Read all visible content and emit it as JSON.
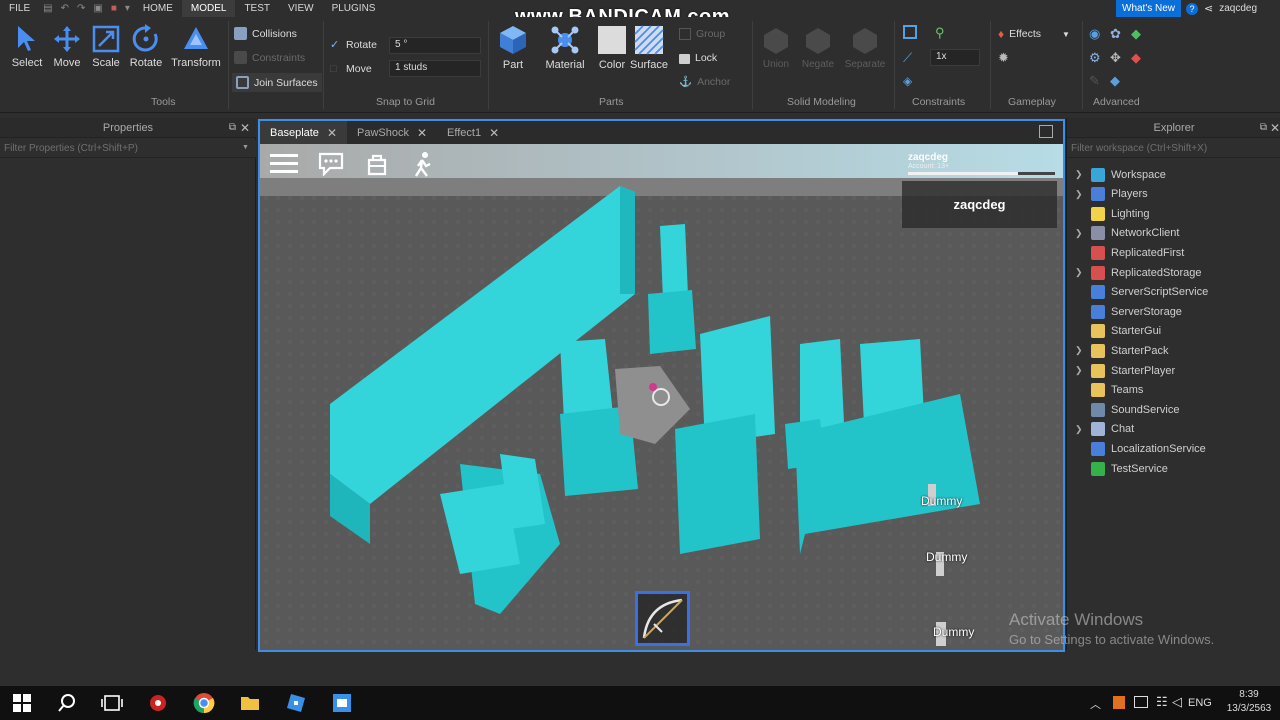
{
  "menubar": {
    "items": [
      "FILE",
      "HOME",
      "MODEL",
      "TEST",
      "VIEW",
      "PLUGINS"
    ],
    "active": "MODEL",
    "whats_new": "What's New",
    "username": "zaqcdeg"
  },
  "watermark": "www.BANDICAM.com",
  "ribbon": {
    "tools": {
      "select": "Select",
      "move": "Move",
      "scale": "Scale",
      "rotate": "Rotate",
      "transform": "Transform",
      "label": "Tools"
    },
    "collisions": "Collisions",
    "constraints_dim": "Constraints",
    "join_surfaces": "Join Surfaces",
    "snap": {
      "rotate_label": "Rotate",
      "rotate_value": "5 °",
      "move_label": "Move",
      "move_value": "1 studs",
      "label": "Snap to Grid"
    },
    "parts": {
      "part": "Part",
      "material": "Material",
      "color": "Color",
      "surface": "Surface",
      "group": "Group",
      "lock": "Lock",
      "anchor": "Anchor",
      "label": "Parts"
    },
    "solid": {
      "union": "Union",
      "negate": "Negate",
      "separate": "Separate",
      "label": "Solid Modeling"
    },
    "constraints": {
      "scale_value": "1x",
      "label": "Constraints"
    },
    "gameplay": {
      "effects": "Effects",
      "label": "Gameplay"
    },
    "advanced": {
      "label": "Advanced"
    }
  },
  "properties": {
    "title": "Properties",
    "filter_placeholder": "Filter Properties (Ctrl+Shift+P)"
  },
  "explorer": {
    "title": "Explorer",
    "filter_placeholder": "Filter workspace (Ctrl+Shift+X)",
    "items": [
      {
        "label": "Workspace",
        "expandable": true,
        "color": "#3aa6d8"
      },
      {
        "label": "Players",
        "expandable": true,
        "color": "#4a7fd9"
      },
      {
        "label": "Lighting",
        "expandable": false,
        "color": "#f1d24a"
      },
      {
        "label": "NetworkClient",
        "expandable": true,
        "color": "#8a8fa6"
      },
      {
        "label": "ReplicatedFirst",
        "expandable": false,
        "color": "#d65050"
      },
      {
        "label": "ReplicatedStorage",
        "expandable": true,
        "color": "#d65050"
      },
      {
        "label": "ServerScriptService",
        "expandable": false,
        "color": "#4a7fd9"
      },
      {
        "label": "ServerStorage",
        "expandable": false,
        "color": "#4a7fd9"
      },
      {
        "label": "StarterGui",
        "expandable": false,
        "color": "#e8c25a"
      },
      {
        "label": "StarterPack",
        "expandable": true,
        "color": "#e8c25a"
      },
      {
        "label": "StarterPlayer",
        "expandable": true,
        "color": "#e8c25a"
      },
      {
        "label": "Teams",
        "expandable": false,
        "color": "#e8c25a"
      },
      {
        "label": "SoundService",
        "expandable": false,
        "color": "#6f8aa8"
      },
      {
        "label": "Chat",
        "expandable": true,
        "color": "#9fb4d8"
      },
      {
        "label": "LocalizationService",
        "expandable": false,
        "color": "#4a7fd9"
      },
      {
        "label": "TestService",
        "expandable": false,
        "color": "#35b04a"
      }
    ]
  },
  "tabs": [
    {
      "label": "Baseplate",
      "active": true
    },
    {
      "label": "PawShock",
      "active": false
    },
    {
      "label": "Effect1",
      "active": false
    }
  ],
  "game": {
    "username": "zaqcdeg",
    "account": "Account: 13+",
    "health_fraction": 0.75,
    "leaderboard_name": "zaqcdeg",
    "dummies": [
      "Dummy",
      "Dummy",
      "Dummy"
    ]
  },
  "activate": {
    "title": "Activate Windows",
    "subtitle": "Go to Settings to activate Windows."
  },
  "taskbar": {
    "lang": "ENG",
    "time": "8:39",
    "date": "13/3/2563"
  },
  "colors": {
    "accent": "#3d8ee6",
    "part_cyan": "#2fd3d8",
    "baseplate": "#6b6b6b"
  }
}
